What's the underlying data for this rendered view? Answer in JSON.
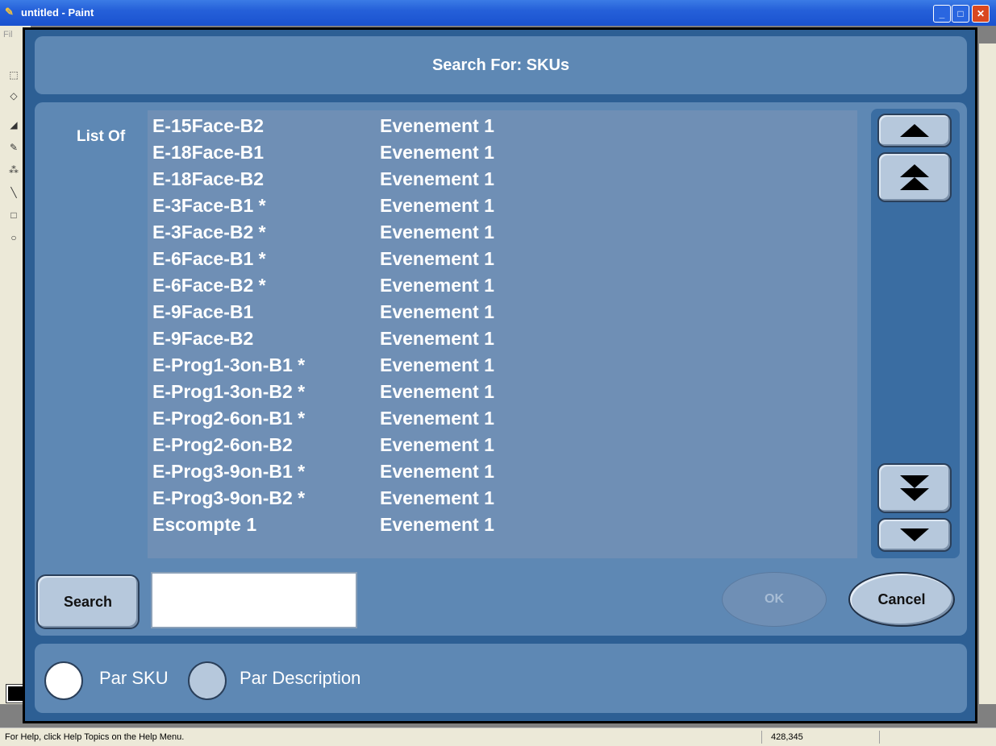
{
  "window": {
    "title": "untitled - Paint",
    "menu_stub": "Fil",
    "minimize": "_",
    "maximize": "□",
    "close": "✕"
  },
  "status": {
    "help_text": "For Help, click Help Topics on the Help Menu.",
    "coords": "428,345"
  },
  "dialog": {
    "title": "Search For: SKUs",
    "list_label": "List Of",
    "items": [
      {
        "sku": "E-15Face-B2",
        "desc": "Evenement 1"
      },
      {
        "sku": "E-18Face-B1",
        "desc": "Evenement 1"
      },
      {
        "sku": "E-18Face-B2",
        "desc": "Evenement 1"
      },
      {
        "sku": "E-3Face-B1 *",
        "desc": "Evenement 1"
      },
      {
        "sku": "E-3Face-B2 *",
        "desc": "Evenement 1"
      },
      {
        "sku": "E-6Face-B1 *",
        "desc": "Evenement 1"
      },
      {
        "sku": "E-6Face-B2 *",
        "desc": "Evenement 1"
      },
      {
        "sku": "E-9Face-B1",
        "desc": "Evenement 1"
      },
      {
        "sku": "E-9Face-B2",
        "desc": "Evenement 1"
      },
      {
        "sku": "E-Prog1-3on-B1 *",
        "desc": "Evenement 1"
      },
      {
        "sku": "E-Prog1-3on-B2 *",
        "desc": "Evenement 1"
      },
      {
        "sku": "E-Prog2-6on-B1 *",
        "desc": "Evenement 1"
      },
      {
        "sku": "E-Prog2-6on-B2",
        "desc": "Evenement 1"
      },
      {
        "sku": "E-Prog3-9on-B1 *",
        "desc": "Evenement 1"
      },
      {
        "sku": "E-Prog3-9on-B2 *",
        "desc": "Evenement 1"
      },
      {
        "sku": "Escompte 1",
        "desc": "Evenement 1"
      }
    ],
    "search_label": "Search",
    "search_value": "",
    "ok_label": "OK",
    "cancel_label": "Cancel",
    "radio_sku_label": "Par SKU",
    "radio_desc_label": "Par Description",
    "selected_radio": "Par SKU"
  },
  "colors": {
    "dialog_bg": "#2d5f94",
    "panel_bg": "#5e88b4",
    "list_bg": "#6f8fb5",
    "button_bg": "#b6c8dc"
  }
}
